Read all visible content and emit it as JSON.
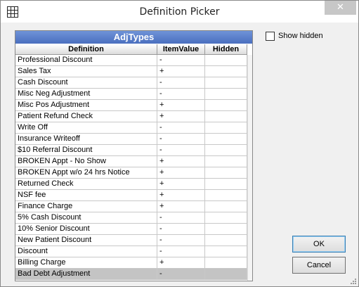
{
  "window": {
    "title": "Definition Picker",
    "close_glyph": "✕"
  },
  "grid": {
    "title": "AdjTypes",
    "columns": [
      "Definition",
      "ItemValue",
      "Hidden"
    ],
    "rows": [
      {
        "definition": "Professional Discount",
        "item_value": "-",
        "hidden": ""
      },
      {
        "definition": "Sales Tax",
        "item_value": "+",
        "hidden": ""
      },
      {
        "definition": "Cash Discount",
        "item_value": "-",
        "hidden": ""
      },
      {
        "definition": "Misc Neg Adjustment",
        "item_value": "-",
        "hidden": ""
      },
      {
        "definition": "Misc Pos Adjustment",
        "item_value": "+",
        "hidden": ""
      },
      {
        "definition": "Patient Refund Check",
        "item_value": "+",
        "hidden": ""
      },
      {
        "definition": "Write Off",
        "item_value": "-",
        "hidden": ""
      },
      {
        "definition": "Insurance Writeoff",
        "item_value": "-",
        "hidden": ""
      },
      {
        "definition": "$10 Referral Discount",
        "item_value": "-",
        "hidden": ""
      },
      {
        "definition": "BROKEN Appt - No Show",
        "item_value": "+",
        "hidden": ""
      },
      {
        "definition": "BROKEN Appt w/o 24 hrs Notice",
        "item_value": "+",
        "hidden": ""
      },
      {
        "definition": "Returned Check",
        "item_value": "+",
        "hidden": ""
      },
      {
        "definition": "NSF fee",
        "item_value": "+",
        "hidden": ""
      },
      {
        "definition": "Finance Charge",
        "item_value": "+",
        "hidden": ""
      },
      {
        "definition": "5% Cash Discount",
        "item_value": "-",
        "hidden": ""
      },
      {
        "definition": "10% Senior Discount",
        "item_value": "-",
        "hidden": ""
      },
      {
        "definition": "New Patient Discount",
        "item_value": "-",
        "hidden": ""
      },
      {
        "definition": "Discount",
        "item_value": "-",
        "hidden": ""
      },
      {
        "definition": "Billing Charge",
        "item_value": "+",
        "hidden": ""
      },
      {
        "definition": "Bad Debt Adjustment",
        "item_value": "-",
        "hidden": ""
      }
    ],
    "selected_row_index": 19
  },
  "show_hidden": {
    "label": "Show hidden",
    "checked": false
  },
  "buttons": {
    "ok": "OK",
    "cancel": "Cancel"
  }
}
